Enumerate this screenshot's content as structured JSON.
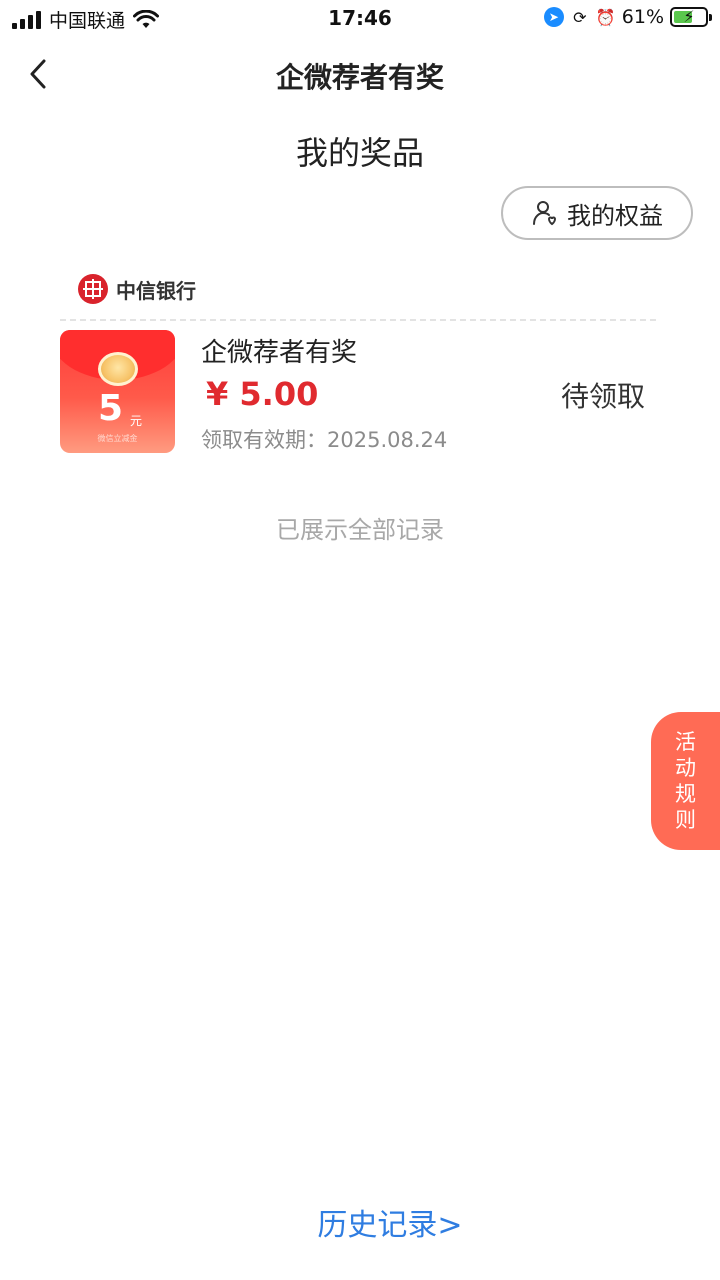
{
  "status_bar": {
    "carrier": "中国联通",
    "time": "17:46",
    "battery_percent": "61%",
    "battery_level": 0.61,
    "icons": [
      "signal-icon",
      "wifi-icon",
      "location-icon",
      "rotation-lock-icon",
      "alarm-icon",
      "battery-charging-icon"
    ]
  },
  "nav": {
    "title": "企微荐者有奖",
    "back_icon": "chevron-left-icon"
  },
  "section": {
    "title": "我的奖品"
  },
  "rights_button": {
    "label": "我的权益",
    "icon": "users-icon"
  },
  "prize_card": {
    "bank_name": "中信银行",
    "bank_logo": "citic-logo",
    "envelope": {
      "amount": "5",
      "unit": "元",
      "caption": "微信立减金"
    },
    "name": "企微荐者有奖",
    "amount": "¥ 5.00",
    "validity": "领取有效期：2025.08.24",
    "status": "待领取"
  },
  "list_footer": "已展示全部记录",
  "rules_tab": "活动规则",
  "history_link": "历史记录>",
  "colors": {
    "accent_red": "#e02a2f",
    "rules_tab": "#ff6b55",
    "link_blue": "#2f7de1"
  }
}
